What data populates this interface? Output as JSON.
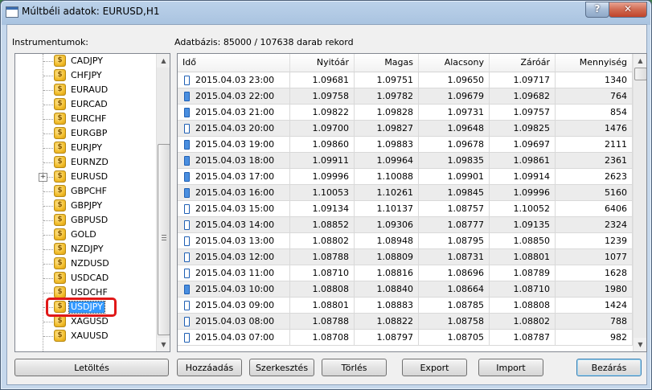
{
  "window": {
    "title": "Múltbéli adatok: EURUSD,H1",
    "help_label": "?",
    "close_label": "✕"
  },
  "tree": {
    "label": "Instrumentumok:",
    "items": [
      {
        "label": "CADJPY"
      },
      {
        "label": "CHFJPY"
      },
      {
        "label": "EURAUD"
      },
      {
        "label": "EURCAD"
      },
      {
        "label": "EURCHF"
      },
      {
        "label": "EURGBP"
      },
      {
        "label": "EURJPY"
      },
      {
        "label": "EURNZD"
      },
      {
        "label": "EURUSD",
        "expander": "+"
      },
      {
        "label": "GBPCHF"
      },
      {
        "label": "GBPJPY"
      },
      {
        "label": "GBPUSD"
      },
      {
        "label": "GOLD"
      },
      {
        "label": "NZDJPY"
      },
      {
        "label": "NZDUSD"
      },
      {
        "label": "USDCAD"
      },
      {
        "label": "USDCHF"
      },
      {
        "label": "USDJPY",
        "selected": true
      },
      {
        "label": "XAGUSD"
      },
      {
        "label": "XAUUSD"
      }
    ],
    "icon_glyph": "$"
  },
  "database": {
    "label": "Adatbázis: 85000 / 107638 darab rekord"
  },
  "table": {
    "columns": [
      "Idő",
      "Nyitóár",
      "Magas",
      "Alacsony",
      "Záróár",
      "Mennyiség"
    ],
    "rows": [
      {
        "time": "2015.04.03 23:00",
        "open": "1.09681",
        "high": "1.09751",
        "low": "1.09650",
        "close": "1.09717",
        "volume": "1340",
        "candle": "bull"
      },
      {
        "time": "2015.04.03 22:00",
        "open": "1.09758",
        "high": "1.09782",
        "low": "1.09679",
        "close": "1.09682",
        "volume": "764",
        "candle": "bear"
      },
      {
        "time": "2015.04.03 21:00",
        "open": "1.09822",
        "high": "1.09828",
        "low": "1.09731",
        "close": "1.09757",
        "volume": "854",
        "candle": "bear"
      },
      {
        "time": "2015.04.03 20:00",
        "open": "1.09700",
        "high": "1.09827",
        "low": "1.09648",
        "close": "1.09825",
        "volume": "1476",
        "candle": "bull"
      },
      {
        "time": "2015.04.03 19:00",
        "open": "1.09860",
        "high": "1.09883",
        "low": "1.09678",
        "close": "1.09697",
        "volume": "2111",
        "candle": "bear"
      },
      {
        "time": "2015.04.03 18:00",
        "open": "1.09911",
        "high": "1.09964",
        "low": "1.09835",
        "close": "1.09861",
        "volume": "2361",
        "candle": "bear"
      },
      {
        "time": "2015.04.03 17:00",
        "open": "1.09996",
        "high": "1.10088",
        "low": "1.09901",
        "close": "1.09914",
        "volume": "2623",
        "candle": "bear"
      },
      {
        "time": "2015.04.03 16:00",
        "open": "1.10053",
        "high": "1.10261",
        "low": "1.09845",
        "close": "1.09996",
        "volume": "5160",
        "candle": "bear"
      },
      {
        "time": "2015.04.03 15:00",
        "open": "1.09134",
        "high": "1.10137",
        "low": "1.08757",
        "close": "1.10052",
        "volume": "6406",
        "candle": "bull"
      },
      {
        "time": "2015.04.03 14:00",
        "open": "1.08852",
        "high": "1.09306",
        "low": "1.08777",
        "close": "1.09135",
        "volume": "2324",
        "candle": "bull"
      },
      {
        "time": "2015.04.03 13:00",
        "open": "1.08802",
        "high": "1.08948",
        "low": "1.08795",
        "close": "1.08850",
        "volume": "1239",
        "candle": "bull"
      },
      {
        "time": "2015.04.03 12:00",
        "open": "1.08788",
        "high": "1.08809",
        "low": "1.08731",
        "close": "1.08801",
        "volume": "1077",
        "candle": "bull"
      },
      {
        "time": "2015.04.03 11:00",
        "open": "1.08710",
        "high": "1.08816",
        "low": "1.08696",
        "close": "1.08789",
        "volume": "1628",
        "candle": "bull"
      },
      {
        "time": "2015.04.03 10:00",
        "open": "1.08808",
        "high": "1.08840",
        "low": "1.08664",
        "close": "1.08710",
        "volume": "1980",
        "candle": "bear"
      },
      {
        "time": "2015.04.03 09:00",
        "open": "1.08801",
        "high": "1.08883",
        "low": "1.08785",
        "close": "1.08808",
        "volume": "1424",
        "candle": "bull"
      },
      {
        "time": "2015.04.03 08:00",
        "open": "1.08788",
        "high": "1.08822",
        "low": "1.08758",
        "close": "1.08802",
        "volume": "788",
        "candle": "bull"
      },
      {
        "time": "2015.04.03 07:00",
        "open": "1.08708",
        "high": "1.08797",
        "low": "1.08705",
        "close": "1.08787",
        "volume": "982",
        "candle": "bull"
      }
    ]
  },
  "buttons": {
    "download": "Letöltés",
    "add": "Hozzáadás",
    "edit": "Szerkesztés",
    "delete": "Törlés",
    "export": "Export",
    "import": "Import",
    "close": "Bezárás"
  },
  "colors": {
    "selection": "#3399ff",
    "highlight_box": "#e01818",
    "candle_border": "#1e5fb4"
  }
}
